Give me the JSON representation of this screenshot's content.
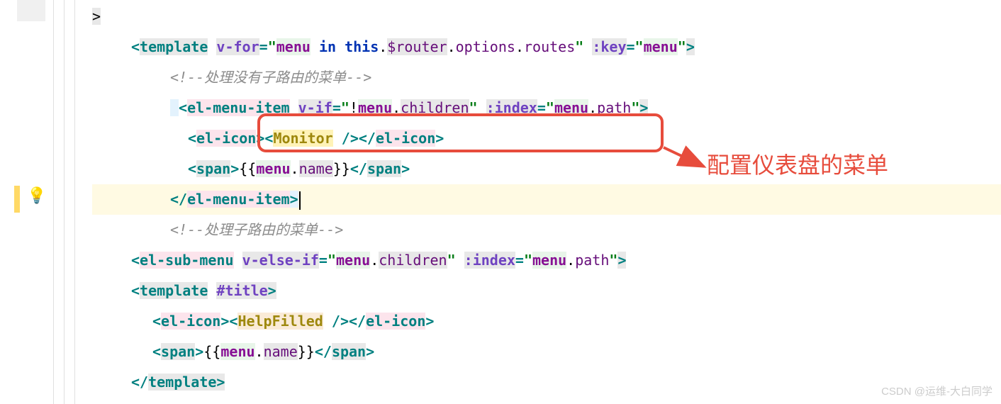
{
  "code": {
    "line1_close": ">",
    "line2": {
      "open": "<",
      "tag": "template",
      "attr": "v-for",
      "eq": "=",
      "q": "\"",
      "var": "menu",
      "in": " in ",
      "this": "this",
      "dot1": ".",
      "router": "$router",
      "dot2": ".",
      "options": "options",
      "dot3": ".",
      "routes": "routes",
      "attr2": ":key",
      "val2": "menu",
      "close": ">"
    },
    "comment1": "<!--处理没有子路由的菜单-->",
    "line4": {
      "open": "<",
      "tag": "el-menu-item",
      "attr1": "v-if",
      "neg": "!",
      "var1": "menu",
      "dot1": ".",
      "children": "children",
      "attr2": ":index",
      "var2": "menu",
      "dot2": ".",
      "path": "path",
      "close": ">"
    },
    "line5": {
      "open1": "<",
      "tag1": "el-icon",
      "close1": ">",
      "open2": "<",
      "comp": "Monitor",
      "selfclose": " />",
      "open3": "</",
      "tag3": "el-icon",
      "close3": ">"
    },
    "line6": {
      "open": "<",
      "tag": "span",
      "close1": ">",
      "expr_open": "{{",
      "var": "menu",
      "dot": ".",
      "name": "name",
      "expr_close": "}}",
      "open2": "</",
      "close2": ">"
    },
    "line7": {
      "open": "</",
      "tag": "el-menu-item",
      "close": ">"
    },
    "comment2": "<!--处理子路由的菜单-->",
    "line9": {
      "open": "<",
      "tag": "el-sub-menu",
      "attr1": "v-else-if",
      "var1": "menu",
      "dot1": ".",
      "children": "children",
      "attr2": ":index",
      "var2": "menu",
      "dot2": ".",
      "path": "path",
      "close": ">"
    },
    "line10": {
      "open": "<",
      "tag": "template",
      "attr": "#title",
      "close": ">"
    },
    "line11": {
      "open1": "<",
      "tag1": "el-icon",
      "close1": ">",
      "open2": "<",
      "comp": "HelpFilled",
      "selfclose": " />",
      "open3": "</",
      "tag3": "el-icon",
      "close3": ">"
    },
    "line12": {
      "open": "<",
      "tag": "span",
      "close1": ">",
      "expr_open": "{{",
      "var": "menu",
      "dot": ".",
      "name": "name",
      "expr_close": "}}",
      "open2": "</",
      "close2": ">"
    },
    "line13": {
      "open": "</",
      "tag": "template",
      "close": ">"
    }
  },
  "annotation": {
    "text": "配置仪表盘的菜单"
  },
  "watermark": "CSDN @运维-大白同学"
}
